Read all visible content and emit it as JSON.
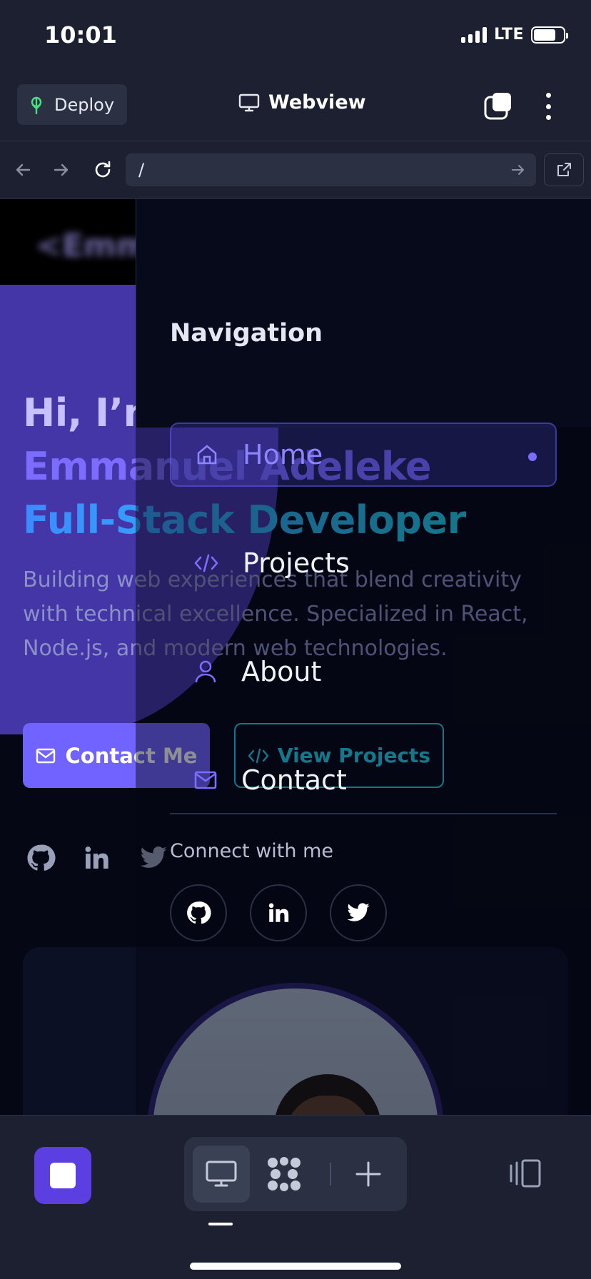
{
  "status_bar": {
    "time": "10:01",
    "network": "LTE"
  },
  "app_header": {
    "deploy_label": "Deploy",
    "title": "Webview"
  },
  "url_bar": {
    "url": "/"
  },
  "page": {
    "hero": {
      "greeting": "Hi, I’m",
      "name": "Emmanuel Adeleke",
      "role": "Full-Stack Developer",
      "description": "Building web experiences that blend creativity with technical excellence. Specialized in React, Node.js, and modern web technologies.",
      "contact_button": "Contact Me",
      "projects_button": "View Projects"
    }
  },
  "drawer": {
    "title": "Navigation",
    "items": [
      {
        "label": "Home",
        "icon": "home-icon",
        "active": true
      },
      {
        "label": "Projects",
        "icon": "code-icon",
        "active": false
      },
      {
        "label": "About",
        "icon": "user-icon",
        "active": false
      },
      {
        "label": "Contact",
        "icon": "mail-icon",
        "active": false
      }
    ],
    "connect_label": "Connect with me",
    "social": [
      "github-icon",
      "linkedin-icon",
      "twitter-icon"
    ]
  },
  "colors": {
    "accent": "#7063ff",
    "cyan": "#22d3ee",
    "page_bg": "#050814",
    "chrome_bg": "#1c2030"
  }
}
